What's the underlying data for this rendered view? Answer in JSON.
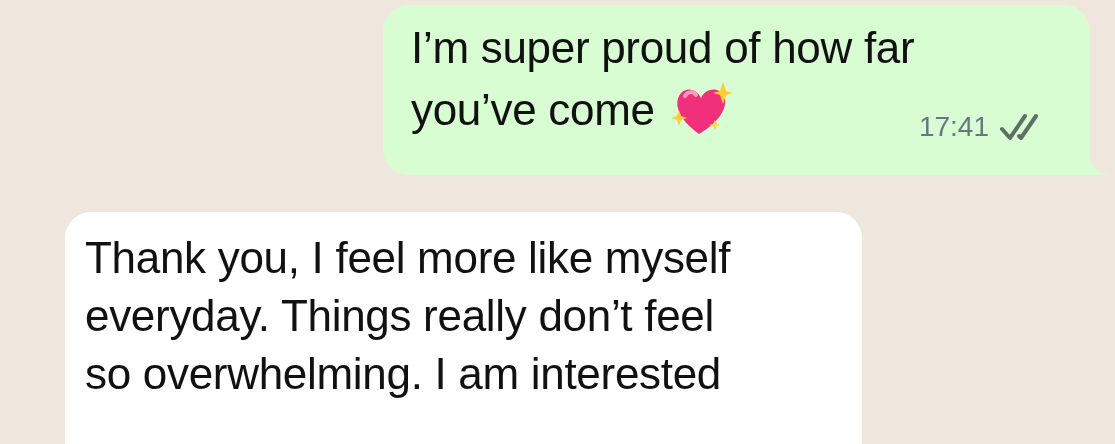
{
  "messages": [
    {
      "kind": "outgoing",
      "lines": [
        "I’m super proud of how far",
        "you’ve come"
      ],
      "sparkling_heart": true,
      "time": "17:41",
      "read": false
    },
    {
      "kind": "incoming",
      "text": "Thank you, I feel more like myself\neveryday. Things really don’t feel\nso overwhelming. I am interested"
    }
  ]
}
